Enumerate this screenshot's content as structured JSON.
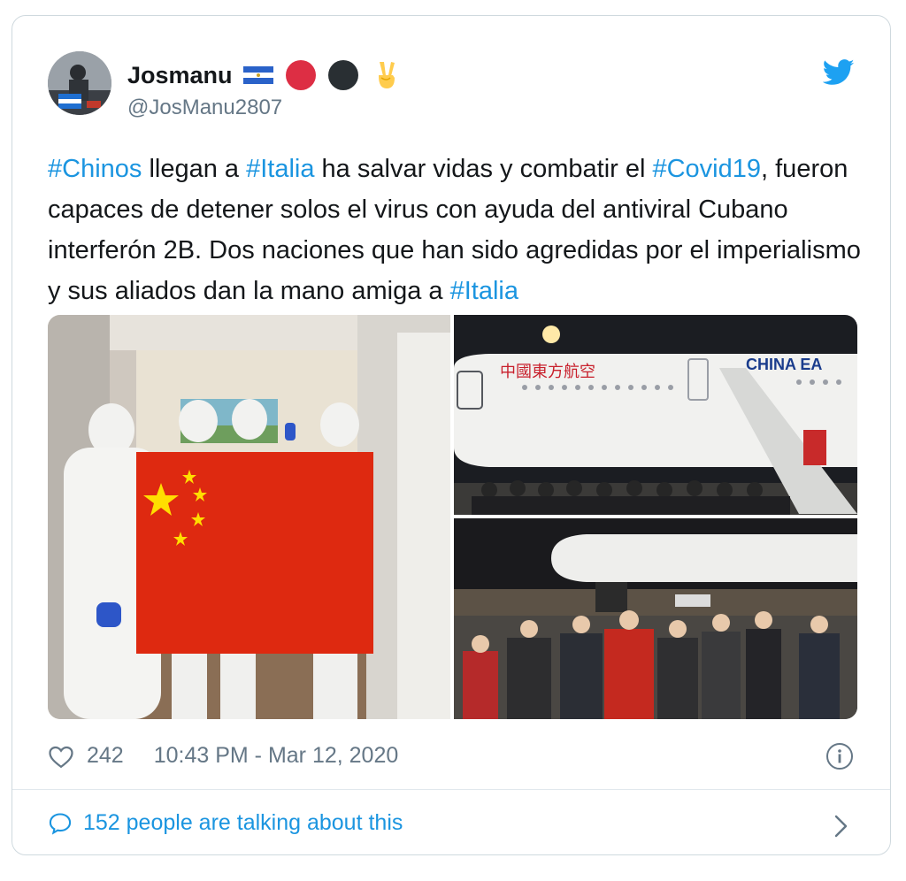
{
  "user": {
    "display_name": "Josmanu",
    "handle": "@JosManu2807",
    "name_emojis": [
      "flag-nicaragua-emoji",
      "red-circle-emoji",
      "black-circle-emoji",
      "victory-hand-emoji"
    ]
  },
  "tweet": {
    "segments": [
      {
        "text": "#Chinos",
        "hashtag": true
      },
      {
        "text": " llegan a ",
        "hashtag": false
      },
      {
        "text": "#Italia",
        "hashtag": true
      },
      {
        "text": " ha salvar vidas y combatir el ",
        "hashtag": false
      },
      {
        "text": "#Covid19",
        "hashtag": true
      },
      {
        "text": ", fueron capaces de detener  solos el virus con ayuda del antiviral Cubano interferón 2B. Dos naciones que han sido agredidas por el imperialismo y sus aliados dan la mano amiga a ",
        "hashtag": false
      },
      {
        "text": "#Italia",
        "hashtag": true
      }
    ],
    "airline_text": "中國東方航空",
    "airline_text_en": "CHINA EA"
  },
  "stats": {
    "likes": "242",
    "timestamp": "10:43 PM - Mar 12, 2020"
  },
  "conversation": {
    "label": "152 people are talking about this"
  },
  "icons": {
    "like": "heart-outline-icon",
    "info": "info-circle-icon",
    "reply": "speech-bubble-icon",
    "brand": "twitter-bird-icon",
    "chevron": "chevron-right-icon"
  },
  "colors": {
    "link": "#1b95e0",
    "muted": "#657786",
    "text": "#14171a",
    "brand": "#1da1f2"
  }
}
